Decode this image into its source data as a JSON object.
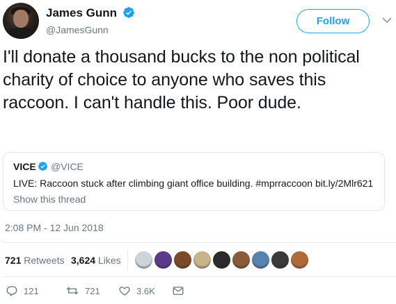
{
  "author": {
    "name": "James Gunn",
    "handle": "@JamesGunn",
    "verified": true,
    "follow_label": "Follow"
  },
  "tweet": {
    "text": "I'll donate a thousand bucks to the non political charity of choice to anyone who saves this raccoon. I can't handle this. Poor dude."
  },
  "quoted": {
    "name": "VICE",
    "handle": "@VICE",
    "verified": true,
    "text": "LIVE: Raccoon stuck after climbing giant office building. #mprraccoon bit.ly/2Mlr621",
    "show_thread": "Show this thread"
  },
  "timestamp": "2:08 PM - 12 Jun 2018",
  "stats": {
    "retweets_count": "721",
    "retweets_label": "Retweets",
    "likes_count": "3,624",
    "likes_label": "Likes"
  },
  "likers": [
    {
      "icon": "liker-avatar",
      "color": "#cfd4d8"
    },
    {
      "icon": "liker-avatar",
      "color": "#5b3b8c"
    },
    {
      "icon": "liker-avatar",
      "color": "#7a4a2a"
    },
    {
      "icon": "liker-avatar",
      "color": "#c9b48a"
    },
    {
      "icon": "liker-avatar",
      "color": "#2b2b2b"
    },
    {
      "icon": "liker-avatar",
      "color": "#8a5a3a"
    },
    {
      "icon": "liker-avatar",
      "color": "#5a82b0"
    },
    {
      "icon": "liker-avatar",
      "color": "#3a3a3a"
    },
    {
      "icon": "liker-avatar",
      "color": "#b06a3a"
    }
  ],
  "actions": {
    "reply_count": "121",
    "retweet_count": "721",
    "like_count": "3.6K"
  },
  "colors": {
    "accent": "#1da1f2",
    "text": "#14171a",
    "muted": "#657786",
    "border": "#e1e8ed"
  }
}
